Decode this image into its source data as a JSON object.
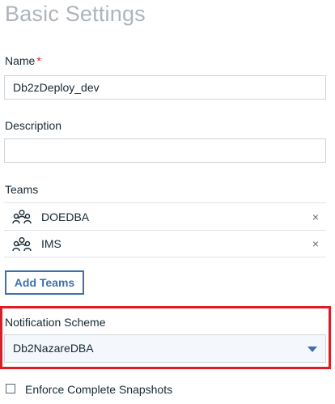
{
  "page": {
    "title": "Basic Settings"
  },
  "name_field": {
    "label": "Name",
    "required_marker": "*",
    "value": "Db2zDeploy_dev"
  },
  "description_field": {
    "label": "Description",
    "value": ""
  },
  "teams": {
    "label": "Teams",
    "items": [
      {
        "name": "DOEDBA",
        "icon": "team-icon",
        "remove": "×"
      },
      {
        "name": "IMS",
        "icon": "team-icon",
        "remove": "×"
      }
    ],
    "add_label": "Add Teams"
  },
  "notification": {
    "label": "Notification Scheme",
    "value": "Db2NazareDBA",
    "highlight_color": "#e01b24"
  },
  "snapshots": {
    "label": "Enforce Complete Snapshots",
    "checked": false
  },
  "colors": {
    "accent": "#3d70b2",
    "required": "#e0182d",
    "title": "#aeb4bb"
  }
}
